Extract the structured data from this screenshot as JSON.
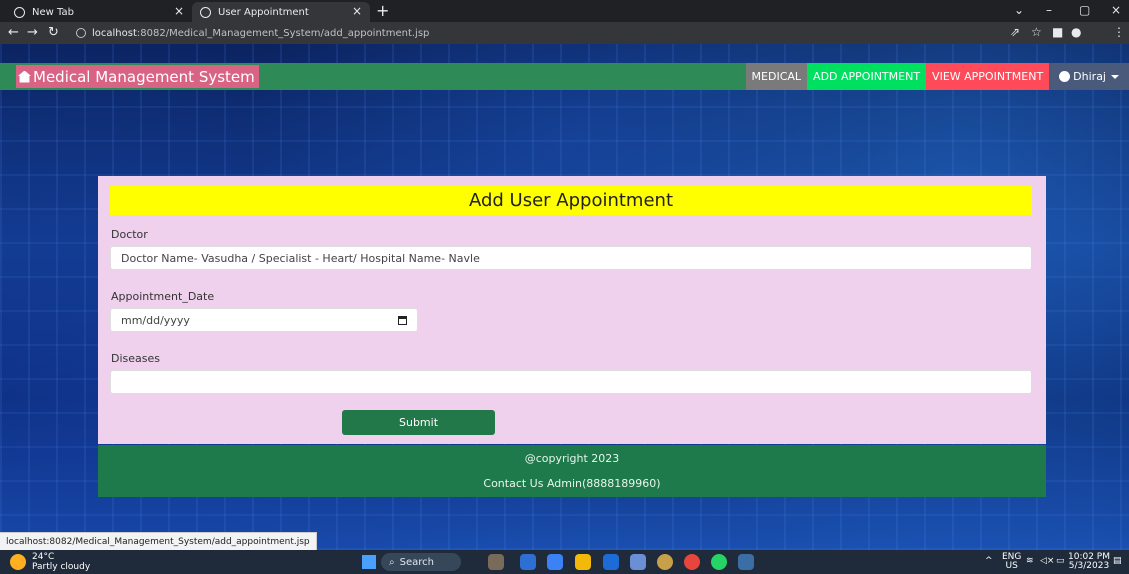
{
  "browser": {
    "tabs": [
      {
        "title": "New Tab"
      },
      {
        "title": "User Appointment"
      }
    ],
    "address": {
      "host": "localhost",
      "rest": ":8082/Medical_Management_System/add_appointment.jsp"
    },
    "status_url": "localhost:8082/Medical_Management_System/add_appointment.jsp"
  },
  "navbar": {
    "brand": "Medical Management System",
    "links": {
      "medical": "MEDICAL",
      "add_appointment": "ADD APPOINTMENT",
      "view_appointment": "VIEW APPOINTMENT",
      "user": "Dhiraj"
    }
  },
  "form": {
    "title": "Add User Appointment",
    "doctor_label": "Doctor",
    "doctor_value": "Doctor Name- Vasudha / Specialist - Heart/ Hospital Name- Navle",
    "date_label": "Appointment_Date",
    "date_placeholder": "mm/dd/yyyy",
    "diseases_label": "Diseases",
    "diseases_value": "",
    "submit_label": "Submit"
  },
  "footer": {
    "copyright": "@copyright 2023",
    "contact": "Contact Us Admin(8888189960)"
  },
  "taskbar": {
    "weather_temp": "24°C",
    "weather_desc": "Partly cloudy",
    "search_label": "Search",
    "lang_top": "ENG",
    "lang_bottom": "US",
    "time": "10:02 PM",
    "date": "5/3/2023"
  },
  "colors": {
    "navbar": "#2e8b57",
    "brand_bg": "#d96384",
    "add_link_bg": "#00e060",
    "view_link_bg": "#ff4a5a",
    "card_bg": "#efd1ee",
    "title_bg": "#ffff00",
    "submit_bg": "#23784a"
  }
}
